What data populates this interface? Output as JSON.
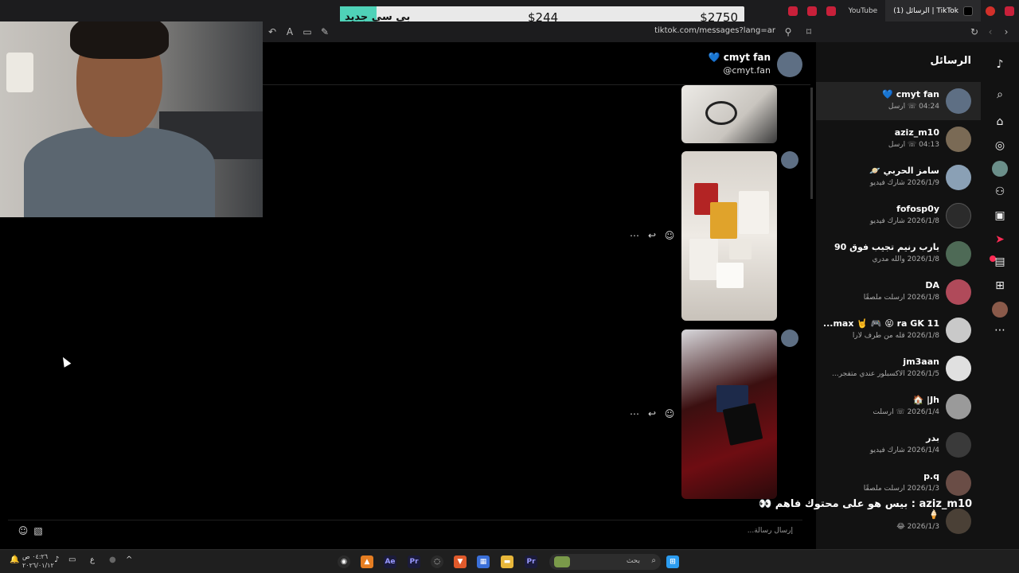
{
  "browser": {
    "tabs": [
      {
        "label": "YouTube",
        "active": false
      },
      {
        "label": "(1) الرسائل | TikTok",
        "active": true
      }
    ],
    "url": "tiktok.com/messages?lang=ar"
  },
  "price_overlay": {
    "new_label": "بي سي جديد",
    "price_1": "$244",
    "price_2": "$2750"
  },
  "inbox": {
    "title": "الرسائل",
    "conversations": [
      {
        "name": "cmyt fan 💙",
        "sub": "04:24 ☏ ارسل",
        "avatar_color": "#5e6f84",
        "selected": true
      },
      {
        "name": "aziz_m10",
        "sub": "04:13 ☏ ارسل",
        "avatar_color": "#7a6a55",
        "selected": false
      },
      {
        "name": "سامز الحربي 🪐",
        "sub": "2026/1/9 شارك فيديو",
        "avatar_color": "#8aa0b5",
        "selected": false
      },
      {
        "name": "fofosp0y",
        "sub": "2026/1/8 شارك فيديو",
        "avatar_color": "#2b2b2b",
        "selected": false
      },
      {
        "name": "يارب رنيم تجيب فوق 90",
        "sub": "2026/1/8 والله مدري",
        "avatar_color": "#4e6a56",
        "selected": false
      },
      {
        "name": "DA",
        "sub": "2026/1/8 ارسلت ملصقًا",
        "avatar_color": "#b04a5a",
        "selected": false
      },
      {
        "name": "max 🤘 🎮 😝 ra GK 11...",
        "sub": "2026/1/8 قله من طرف لارا",
        "avatar_color": "#c9c9c9",
        "selected": false
      },
      {
        "name": "jm3aan",
        "sub": "2026/1/5 الاكسبلور عندي متفجر...",
        "avatar_color": "#e0e0e0",
        "selected": false
      },
      {
        "name": "Jh| 🏠",
        "sub": "2026/1/4 ☏ ارسلت",
        "avatar_color": "#9a9a9a",
        "selected": false
      },
      {
        "name": "بدر",
        "sub": "2026/1/4 شارك فيديو",
        "avatar_color": "#3a3a3a",
        "selected": false
      },
      {
        "name": "p.q",
        "sub": "2026/1/3 ارسلت ملصقًا",
        "avatar_color": "#6a4d46",
        "selected": false
      },
      {
        "name": "🍦",
        "sub": "2026/1/3 😂",
        "avatar_color": "#4a4036",
        "selected": false
      }
    ]
  },
  "chat": {
    "name": "cmyt fan 💙",
    "handle": "cmyt.fan@",
    "composer_placeholder": "إرسال رسالة..."
  },
  "overlay_comment": "aziz_m10 : بيس هو على محتوك فاهم 👀",
  "icons": {
    "more": "⋯",
    "reply": "↩",
    "emoji": "☺"
  },
  "taskbar": {
    "search_placeholder": "بحث",
    "time": "٠٤:٢٦ ص",
    "date": "٢٠٢٦/٠١/١٢",
    "lang": "ع"
  }
}
